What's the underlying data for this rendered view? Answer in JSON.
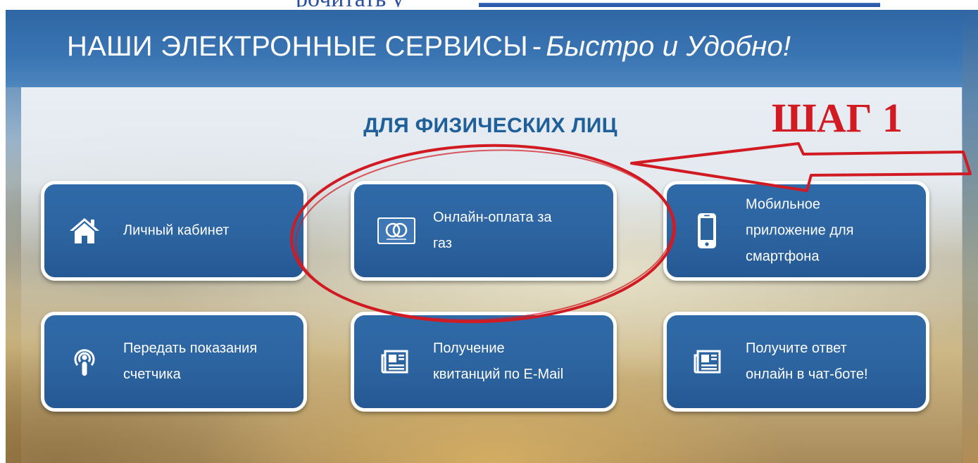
{
  "top_cut_text": "рочитать у",
  "header": {
    "title_main": "НАШИ ЭЛЕКТРОННЫЕ СЕРВИСЫ",
    "title_dash": "-",
    "title_italic": "Быстро и Удобно!"
  },
  "section": {
    "title": "ДЛЯ ФИЗИЧЕСКИХ ЛИЦ"
  },
  "annotation": {
    "step_label": "ШАГ 1",
    "color": "#d11a22"
  },
  "colors": {
    "tile_blue": "#2c64a0",
    "header_blue": "#3a75b3",
    "section_title": "#1f5f9a"
  },
  "tiles": [
    {
      "label": "Личный кабинет",
      "icon": "home-icon"
    },
    {
      "label": "Онлайн-оплата за\nгаз",
      "icon": "mastercard-icon"
    },
    {
      "label": "Мобильное\nприложение для\nсмартфона",
      "icon": "smartphone-icon"
    },
    {
      "label": "Передать показания\nсчетчика",
      "icon": "podcast-icon"
    },
    {
      "label": "Получение\nквитанций по E-Mail",
      "icon": "newspaper-icon"
    },
    {
      "label": "Получите ответ\nонлайн в чат-боте!",
      "icon": "newspaper-icon"
    }
  ]
}
